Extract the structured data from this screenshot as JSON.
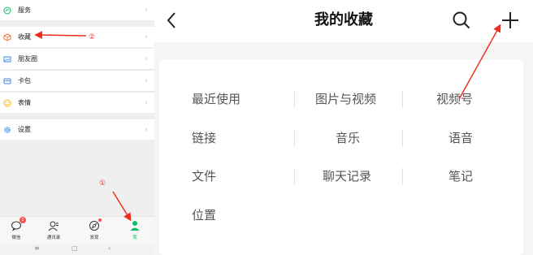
{
  "left_menu": [
    {
      "label": "服务",
      "icon": "service-icon"
    },
    {
      "label": "收藏",
      "icon": "favorites-icon"
    },
    {
      "label": "朋友圈",
      "icon": "moments-icon"
    },
    {
      "label": "卡包",
      "icon": "card-wallet-icon"
    },
    {
      "label": "表情",
      "icon": "sticker-icon"
    },
    {
      "label": "设置",
      "icon": "settings-icon"
    }
  ],
  "chevron": "›",
  "tabbar": [
    {
      "label": "微信",
      "icon": "chats-icon",
      "badge": "1"
    },
    {
      "label": "通讯录",
      "icon": "contacts-icon"
    },
    {
      "label": "发现",
      "icon": "discover-icon",
      "dot": true
    },
    {
      "label": "我",
      "icon": "me-icon",
      "active": true
    }
  ],
  "system_nav": {
    "menu": "≡",
    "home": "▢",
    "back": "‹"
  },
  "annotations": {
    "step1": "①",
    "step2": "②"
  },
  "favorites": {
    "title": "我的收藏",
    "back_glyph": "‹",
    "add_glyph": "+",
    "categories": [
      [
        "最近使用",
        "图片与视频",
        "视频号"
      ],
      [
        "链接",
        "音乐",
        "语音"
      ],
      [
        "文件",
        "聊天记录",
        "笔记"
      ],
      [
        "位置"
      ]
    ]
  },
  "colors": {
    "accent": "#07c160",
    "arrow": "#ee2b1e",
    "badge": "#fa5151"
  }
}
